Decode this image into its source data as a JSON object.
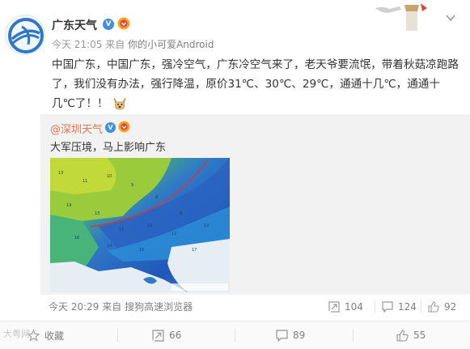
{
  "post": {
    "username": "广东天气",
    "time": "今天 21:05",
    "from_label": "来自",
    "source": "你的小可爱Android",
    "text": "中国广东，中国广东，强冷空气，广东冷空气来了，老天爷要流氓，带着秋菇凉跑路了，我们没有办法，强行降温，原价31℃、30℃、29℃，通通十几℃，通通十几℃了！！",
    "emoji": "doge"
  },
  "repost": {
    "username": "@深圳天气",
    "text": "大军压境，马上影响广东",
    "footer": {
      "time": "今天 20:29",
      "from_label": "来自",
      "source": "搜狗高速浏览器",
      "repost_count": "104",
      "comment_count": "124",
      "like_count": "92"
    }
  },
  "actions": {
    "favorite_label": "收藏",
    "repost_count": "66",
    "comment_count": "89",
    "like_count": "55"
  },
  "watermark": "大粤网",
  "colors": {
    "link": "#eb7350",
    "verified": "#3d8fe0",
    "muted": "#808080",
    "repost_bg": "#f2f2f2"
  },
  "icons": [
    "avatar-logo-icon",
    "verified-icon",
    "vip-icon",
    "decor-icon",
    "chevron-down-icon",
    "doge-emoji-icon",
    "repost-icon",
    "comment-icon",
    "like-icon",
    "star-icon"
  ]
}
